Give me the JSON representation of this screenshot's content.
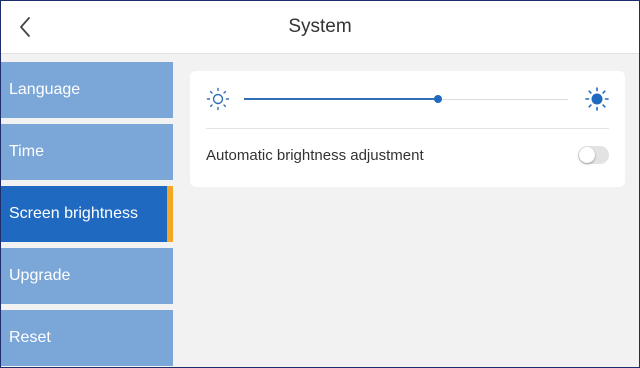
{
  "header": {
    "title": "System",
    "back_icon": "chevron-left-icon"
  },
  "sidebar": {
    "items": [
      {
        "label": "Language"
      },
      {
        "label": "Time"
      },
      {
        "label": "Screen brightness",
        "active": true
      },
      {
        "label": "Upgrade"
      },
      {
        "label": "Reset"
      }
    ],
    "active_color": "#1f69c0",
    "inactive_color": "#7aa6d8",
    "marker_color": "#f5a623"
  },
  "brightness": {
    "low_icon": "sun-outline-icon",
    "high_icon": "sun-filled-icon",
    "level": 0.6,
    "auto_label": "Automatic brightness adjustment",
    "auto_enabled": false
  },
  "colors": {
    "accent": "#1f69c0",
    "background": "#f2f2f2"
  }
}
